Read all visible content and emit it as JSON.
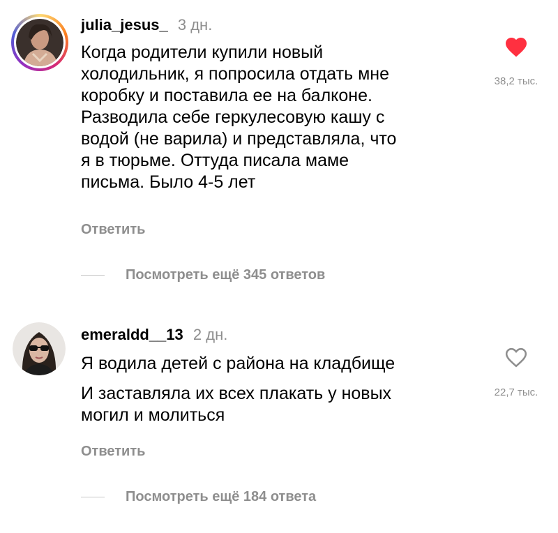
{
  "comments": [
    {
      "username": "julia_jesus_",
      "time": "3 дн.",
      "lines": [
        "Когда родители купили новый",
        "холодильник, я попросила отдать мне",
        "коробку и поставила ее на балконе.",
        "Разводила себе геркулесовую кашу с",
        "водой (не варила) и представляла, что",
        "я в тюрьме. Оттуда писала маме",
        "письма. Было 4-5 лет"
      ],
      "liked": true,
      "like_count": "38,2 тыс.",
      "reply_label": "Ответить",
      "more_replies": "Посмотреть ещё 345 ответов",
      "icons": {
        "avatar": "avatar-story-ring",
        "like": "heart-filled-icon"
      }
    },
    {
      "username": "emeraldd__13",
      "time": "2 дн.",
      "lines": [
        "Я водила детей с района на кладбище",
        "И заставляла их всех плакать у новых",
        "могил и молиться"
      ],
      "liked": false,
      "like_count": "22,7 тыс.",
      "reply_label": "Ответить",
      "more_replies": "Посмотреть ещё 184 ответа",
      "icons": {
        "avatar": "avatar-plain",
        "like": "heart-outline-icon"
      }
    }
  ],
  "colors": {
    "heart_red": "#ff3040",
    "secondary_text": "#8e8e8e"
  }
}
